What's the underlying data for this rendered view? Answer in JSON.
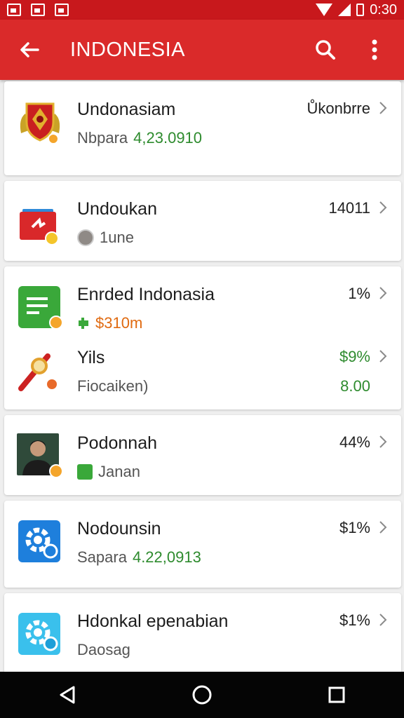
{
  "status_bar": {
    "time": "0:30",
    "icons": [
      "image-icon",
      "notes-icon",
      "gallery-icon",
      "wifi-icon",
      "signal-icon",
      "battery-icon"
    ]
  },
  "app_bar": {
    "title": "INDONESIA",
    "back_icon": "arrow-left-icon",
    "search_icon": "search-icon",
    "more_icon": "more-vertical-icon"
  },
  "items": [
    {
      "title": "Undonasiam",
      "subtitle_prefix": "Nbpara",
      "subtitle_number": "4,23.0910",
      "value": "Ůkonbrre",
      "icon": "coat-of-arms-icon"
    },
    {
      "title": "Undoukan",
      "subtitle": "1une",
      "value": "14011",
      "icon": "red-flag-card-icon"
    },
    {
      "title": "Enrded Indonasia",
      "subtitle": "$310m",
      "value": "1%",
      "icon": "green-document-icon"
    },
    {
      "title": "Yils",
      "subtitle": "Fiocaiken)",
      "value": "$9%",
      "value2": "8.00",
      "icon": "key-ribbon-icon"
    },
    {
      "title": "Podonnah",
      "subtitle": "Janan",
      "value": "44%",
      "icon": "person-photo-icon"
    },
    {
      "title": "Nodounsin",
      "subtitle_prefix": "Sapara",
      "subtitle_number": "4.22,0913",
      "value": "$1%",
      "icon": "blue-settings-icon"
    },
    {
      "title": "Hdonkal epenabian",
      "subtitle": "Daosag",
      "value": "$1%",
      "icon": "light-blue-settings-icon"
    }
  ],
  "nav_bar": {
    "back": "triangle-back-icon",
    "home": "circle-home-icon",
    "recents": "square-recents-icon"
  },
  "colors": {
    "status_bar": "#c8181c",
    "app_bar": "#da2a2a",
    "green": "#2e8b2e",
    "orange": "#e06a10"
  }
}
